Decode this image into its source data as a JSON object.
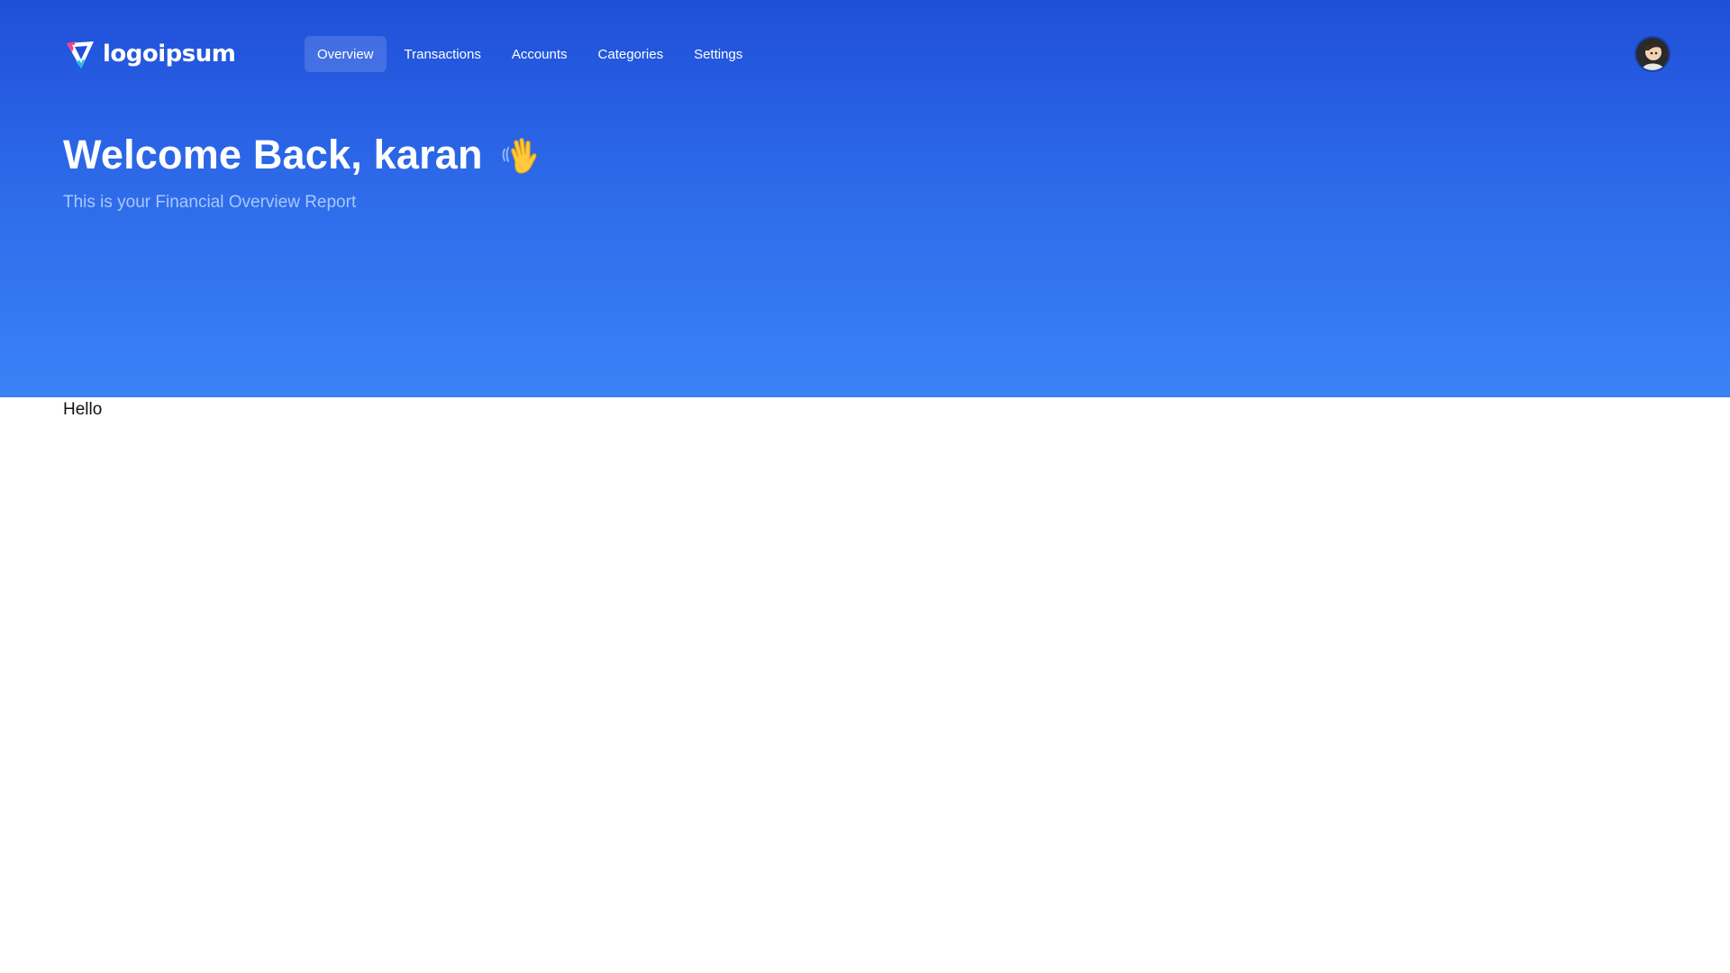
{
  "brand": {
    "logo_text": "logoipsum",
    "colors": {
      "hero_gradient_top": "#1f4fd9",
      "hero_gradient_bottom": "#3a82f6",
      "text_light": "#ffffff",
      "subtitle": "#a9c8ff"
    }
  },
  "nav": {
    "items": [
      {
        "label": "Overview",
        "active": true
      },
      {
        "label": "Transactions",
        "active": false
      },
      {
        "label": "Accounts",
        "active": false
      },
      {
        "label": "Categories",
        "active": false
      },
      {
        "label": "Settings",
        "active": false
      }
    ]
  },
  "user": {
    "avatar_icon": "user-avatar"
  },
  "hero": {
    "title": "Welcome Back, karan",
    "emoji_icon": "waving-hand-icon",
    "subtitle": "This is your Financial Overview Report"
  },
  "main": {
    "text": "Hello"
  }
}
